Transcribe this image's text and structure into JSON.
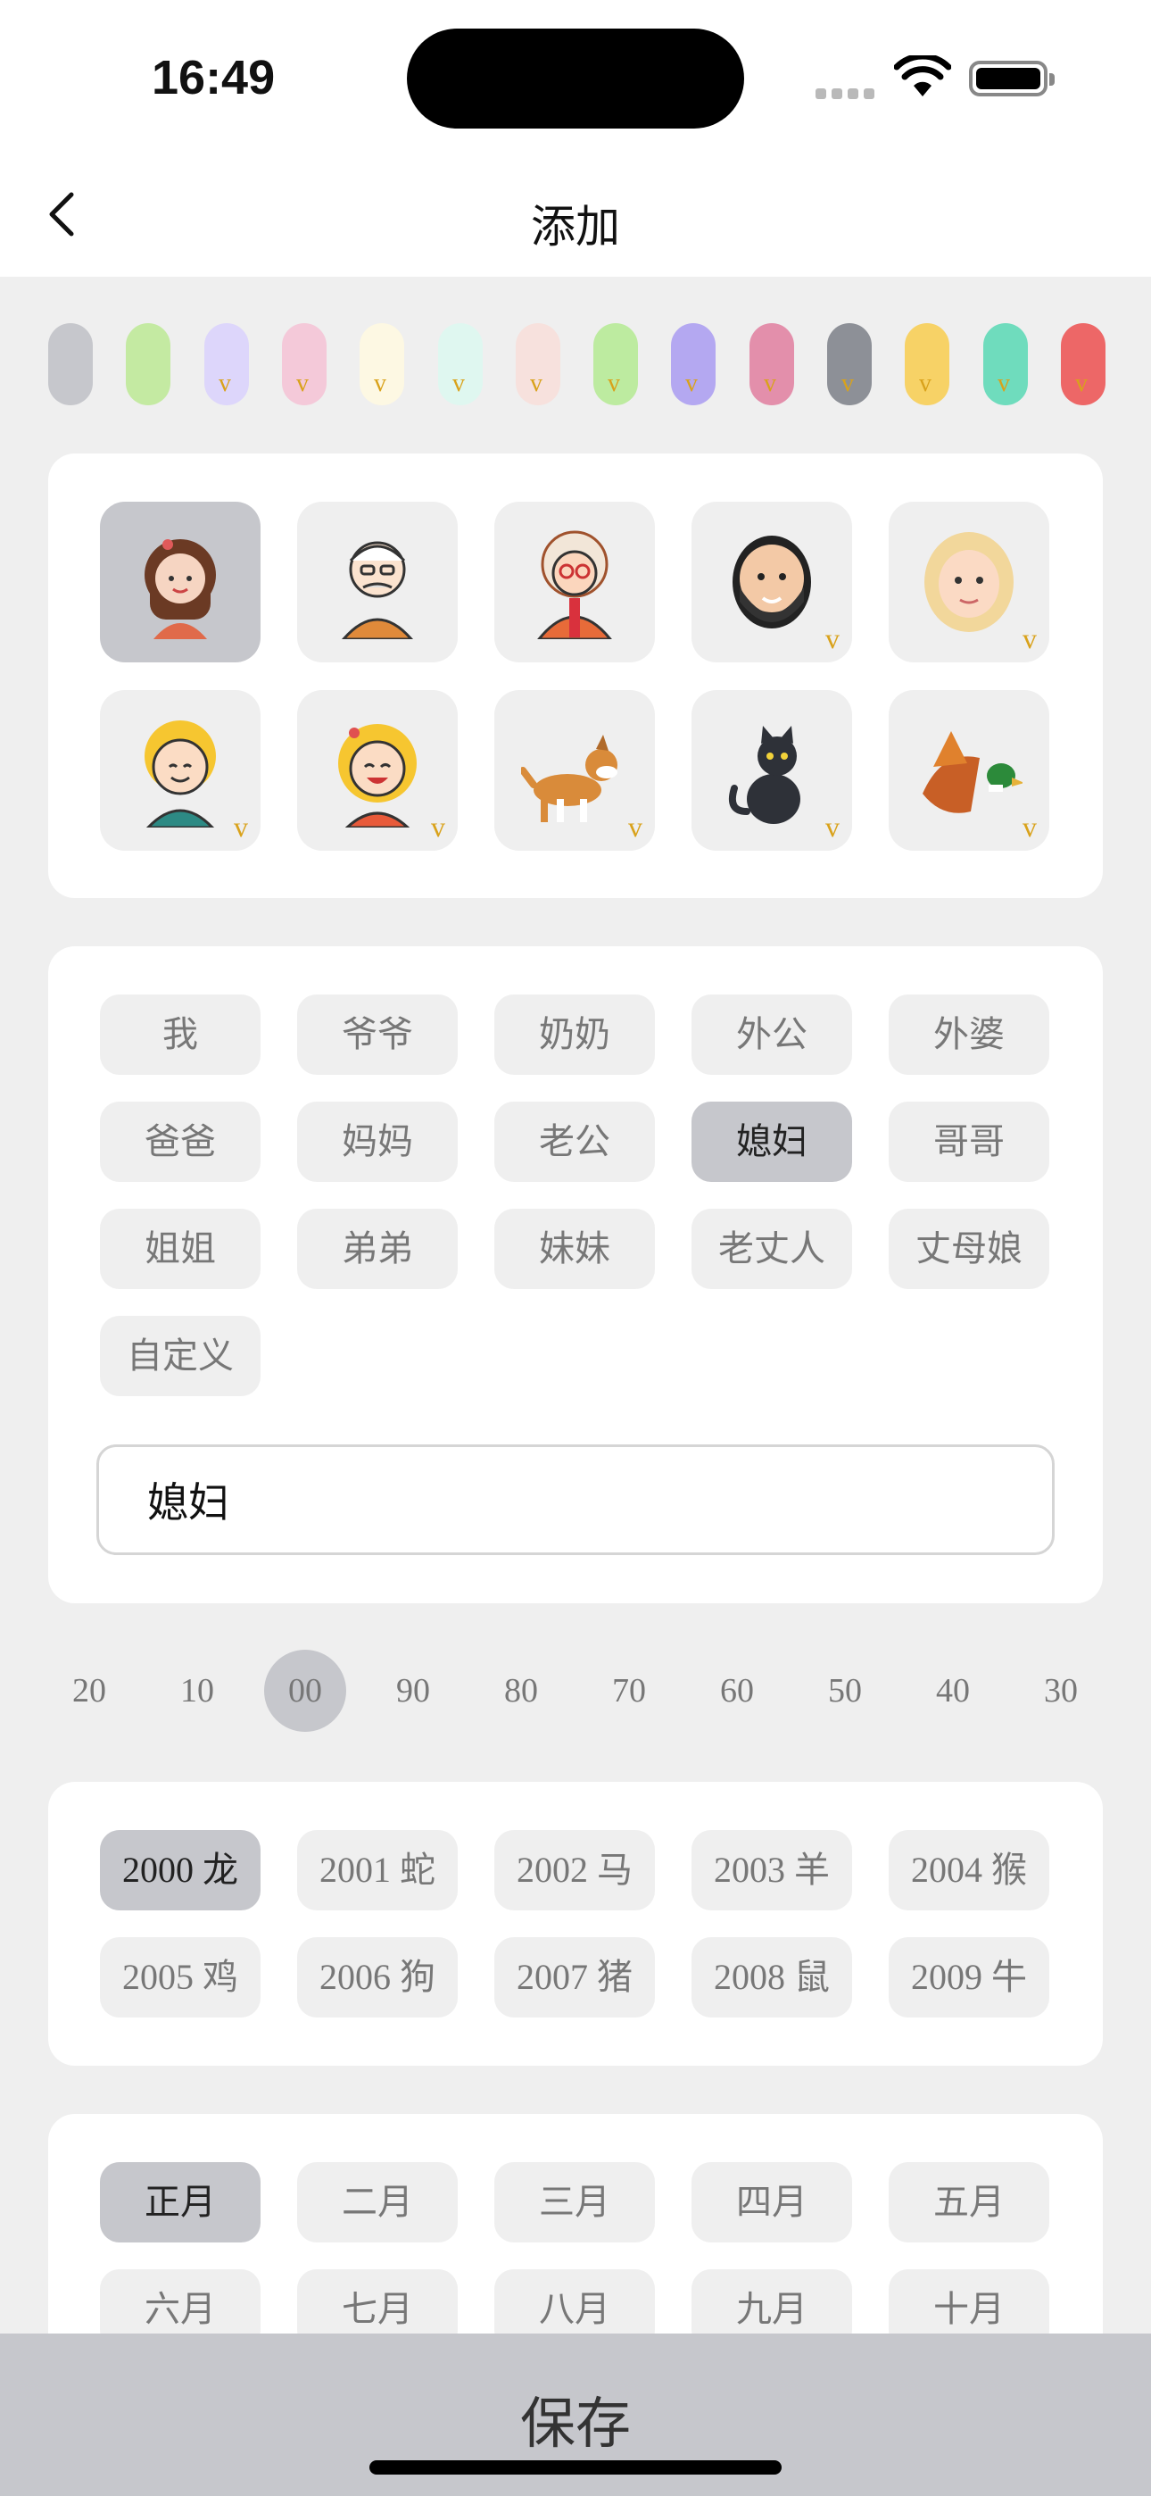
{
  "status": {
    "time": "16:49"
  },
  "nav": {
    "title": "添加"
  },
  "colors": [
    {
      "hex": "#c6c7cc",
      "vip": false
    },
    {
      "hex": "#c4eaa2",
      "vip": false
    },
    {
      "hex": "#ddd6fb",
      "vip": true
    },
    {
      "hex": "#f4c9d9",
      "vip": true
    },
    {
      "hex": "#fdf8e3",
      "vip": true
    },
    {
      "hex": "#dff7f0",
      "vip": true
    },
    {
      "hex": "#f7e1dd",
      "vip": true
    },
    {
      "hex": "#bdeba0",
      "vip": true
    },
    {
      "hex": "#b4a8f1",
      "vip": true
    },
    {
      "hex": "#e38fab",
      "vip": true
    },
    {
      "hex": "#8d9097",
      "vip": true
    },
    {
      "hex": "#f7d266",
      "vip": true
    },
    {
      "hex": "#6fdcbd",
      "vip": true
    },
    {
      "hex": "#ed6767",
      "vip": true
    }
  ],
  "vip_mark": "v",
  "avatars": [
    {
      "icon": "girl-avatar-icon",
      "vip": false
    },
    {
      "icon": "grandpa-avatar-icon",
      "vip": false
    },
    {
      "icon": "grandma-avatar-icon",
      "vip": false
    },
    {
      "icon": "bearded-man-avatar-icon",
      "vip": true
    },
    {
      "icon": "blonde-woman-avatar-icon",
      "vip": true
    },
    {
      "icon": "boy-avatar-icon",
      "vip": true
    },
    {
      "icon": "smiling-girl-avatar-icon",
      "vip": true
    },
    {
      "icon": "dog-avatar-icon",
      "vip": true
    },
    {
      "icon": "cat-avatar-icon",
      "vip": true
    },
    {
      "icon": "duck-avatar-icon",
      "vip": true
    }
  ],
  "relations": {
    "items": [
      "我",
      "爷爷",
      "奶奶",
      "外公",
      "外婆",
      "爸爸",
      "妈妈",
      "老公",
      "媳妇",
      "哥哥",
      "姐姐",
      "弟弟",
      "妹妹",
      "老丈人",
      "丈母娘",
      "自定义"
    ],
    "selected": "媳妇",
    "name_value": "媳妇"
  },
  "decades": {
    "items": [
      "20",
      "10",
      "00",
      "90",
      "80",
      "70",
      "60",
      "50",
      "40",
      "30"
    ],
    "selected": "00"
  },
  "years": {
    "items": [
      "2000 龙",
      "2001 蛇",
      "2002 马",
      "2003 羊",
      "2004 猴",
      "2005 鸡",
      "2006 狗",
      "2007 猪",
      "2008 鼠",
      "2009 牛"
    ],
    "selected": "2000 龙"
  },
  "months": {
    "items": [
      "正月",
      "二月",
      "三月",
      "四月",
      "五月",
      "六月",
      "七月",
      "八月",
      "九月",
      "十月"
    ],
    "selected": "正月"
  },
  "save": {
    "label": "保存"
  },
  "accent": {
    "selected_bg": "#c6c7cc",
    "vip_color": "#d9a21b"
  }
}
